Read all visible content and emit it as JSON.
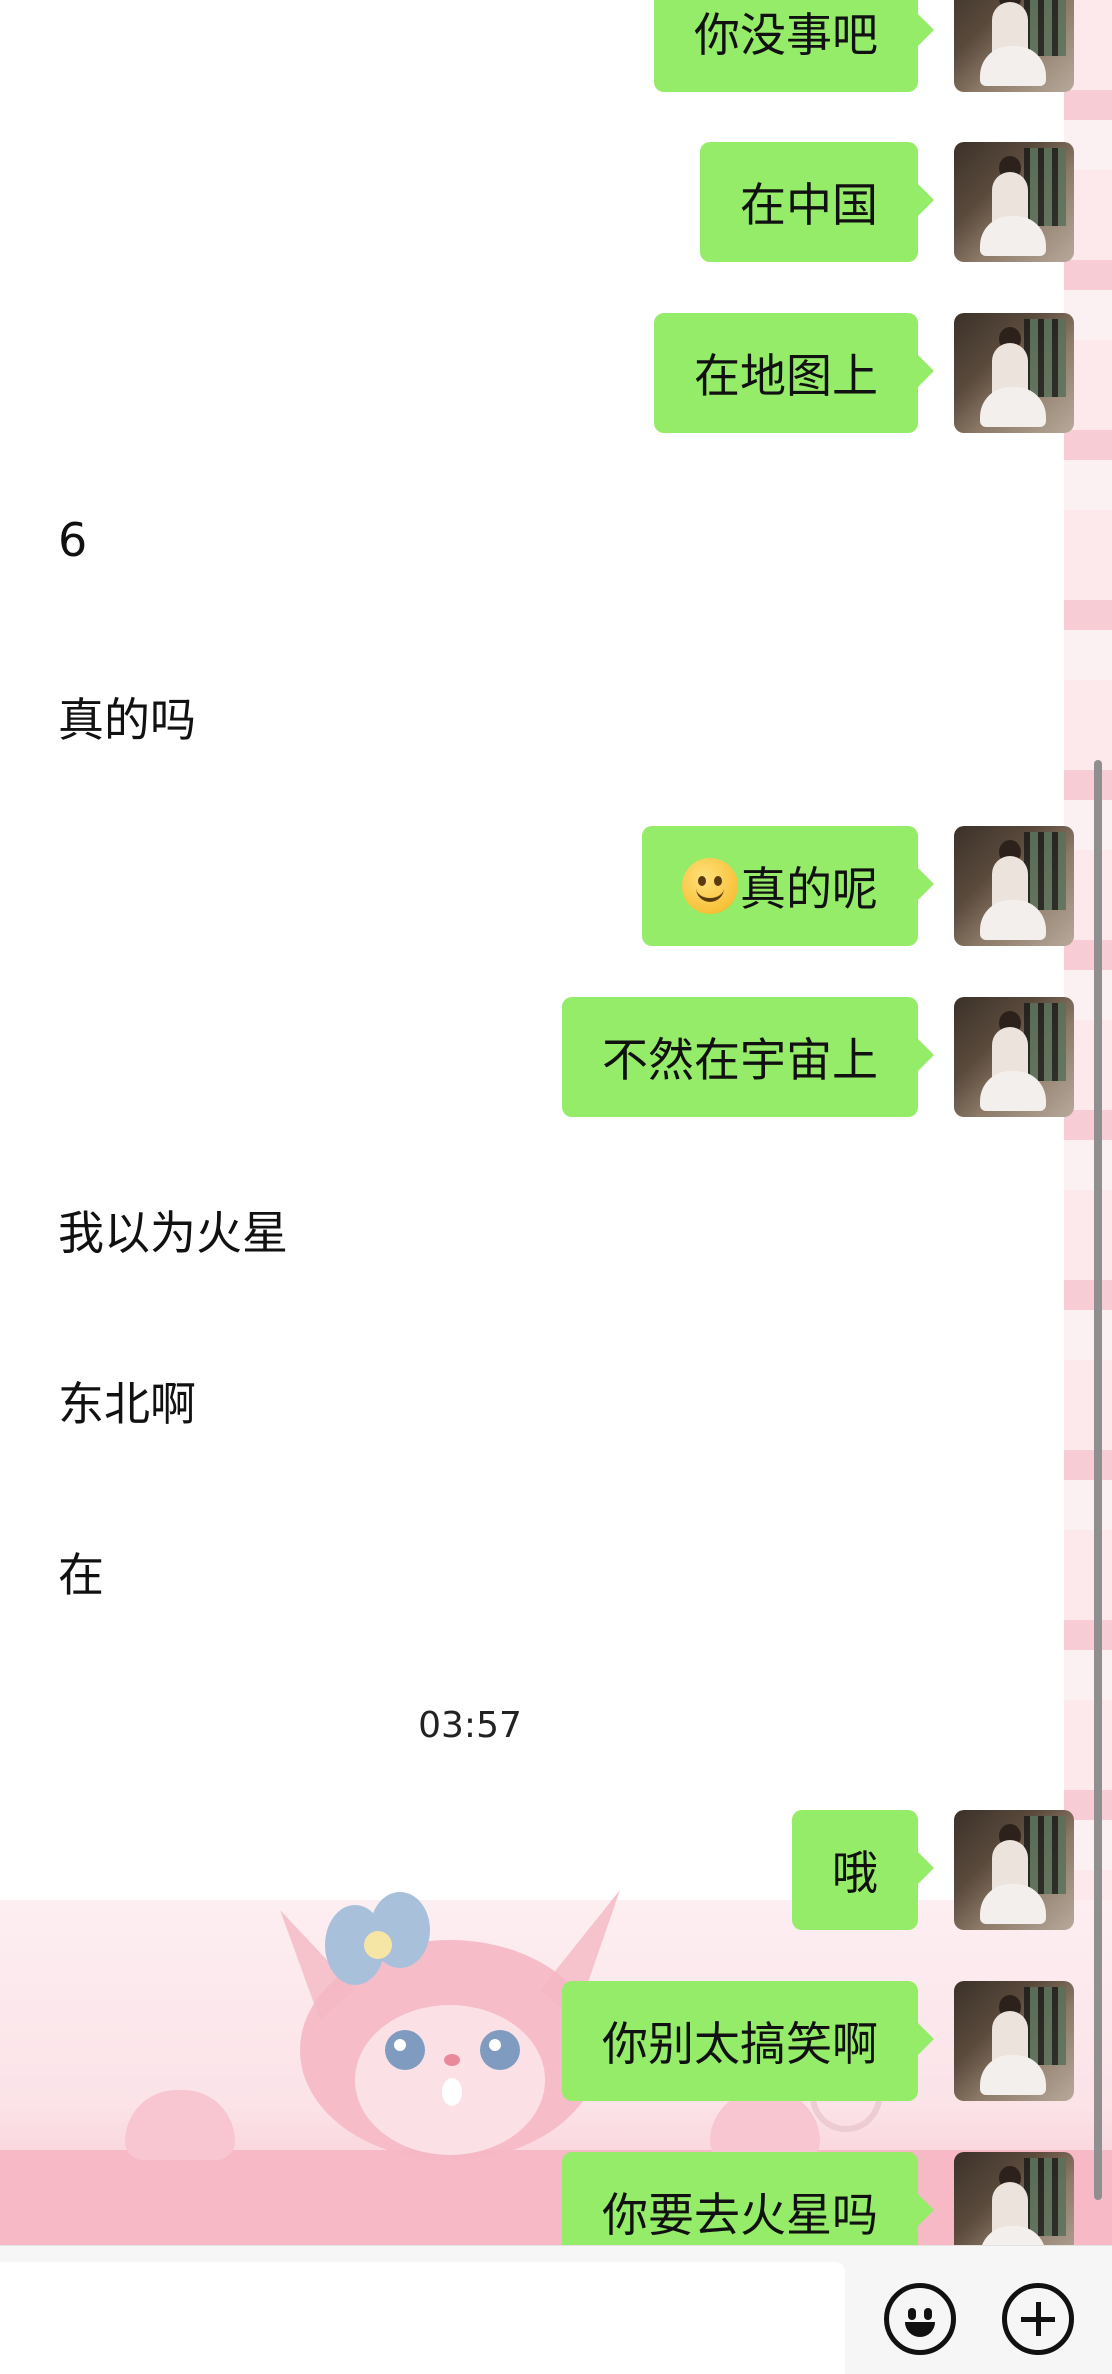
{
  "conversation": {
    "messages": [
      {
        "side": "out",
        "text": "你没事吧"
      },
      {
        "side": "out",
        "text": "在中国"
      },
      {
        "side": "out",
        "text": "在地图上"
      },
      {
        "side": "in",
        "text": "6"
      },
      {
        "side": "in",
        "text": "真的吗"
      },
      {
        "side": "out",
        "text": "真的呢",
        "emoji": "smiley"
      },
      {
        "side": "out",
        "text": "不然在宇宙上"
      },
      {
        "side": "in",
        "text": "我以为火星"
      },
      {
        "side": "in",
        "text": "东北啊"
      },
      {
        "side": "in",
        "text": "在"
      },
      {
        "side": "out",
        "text": "哦"
      },
      {
        "side": "out",
        "text": "你别太搞笑啊"
      },
      {
        "side": "out",
        "text": "你要去火星吗"
      }
    ],
    "timestamp": "03:57"
  },
  "input_bar": {
    "message_value": "",
    "emoji_icon": "smiley-face-icon",
    "plus_icon": "plus-circle-icon"
  },
  "colors": {
    "outgoing_bubble": "#95ec69",
    "wallpaper_pink": "#f7b9c5"
  }
}
